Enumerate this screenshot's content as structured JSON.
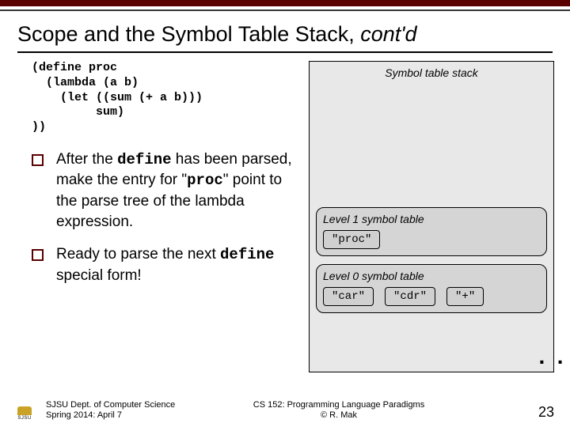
{
  "title": {
    "plain": "Scope and the Symbol Table Stack, ",
    "italic": "cont'd"
  },
  "code": "(define proc\n  (lambda (a b)\n    (let ((sum (+ a b)))\n         sum)\n))",
  "bullets": [
    {
      "pre": "After the ",
      "mono1": "define",
      "mid": " has been parsed, make the entry for \"",
      "mono2": "proc",
      "post": "\" point to the parse tree of the lambda expression."
    },
    {
      "pre": "Ready to parse the next ",
      "mono1": "define",
      "mid": " special form!",
      "mono2": "",
      "post": ""
    }
  ],
  "stack": {
    "title": "Symbol table stack",
    "tables": [
      {
        "label": "Level 1 symbol table",
        "entries": [
          "\"proc\""
        ]
      },
      {
        "label": "Level 0 symbol table",
        "entries": [
          "\"car\"",
          "\"cdr\"",
          "\"+\""
        ]
      }
    ],
    "ellipsis": "· · ·"
  },
  "footer": {
    "left1": "SJSU Dept. of Computer Science",
    "left2": "Spring 2014: April 7",
    "mid1": "CS 152: Programming Language Paradigms",
    "mid2": "© R. Mak",
    "page": "23"
  }
}
